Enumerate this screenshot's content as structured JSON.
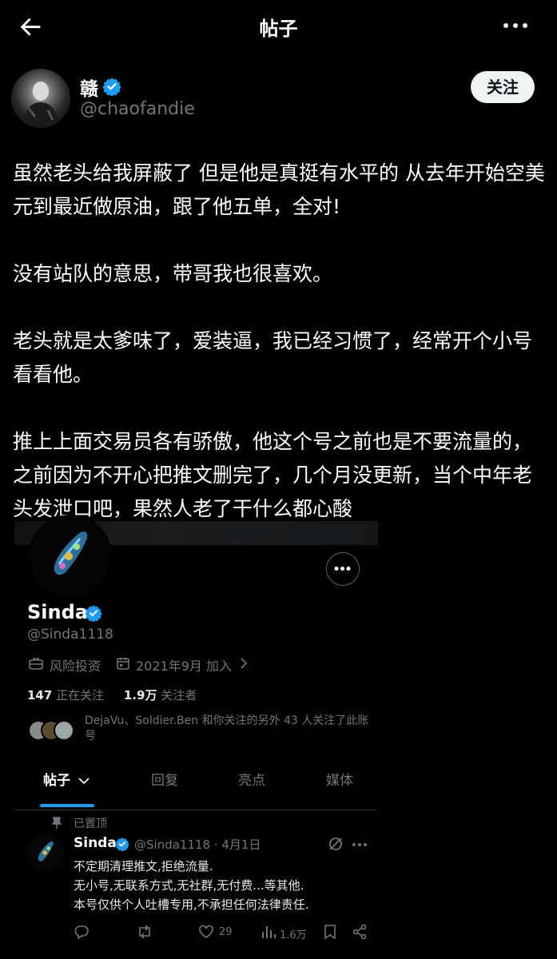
{
  "topbar": {
    "title": "帖子"
  },
  "author": {
    "name": "赣",
    "handle": "@chaofandie",
    "follow_label": "关注"
  },
  "post": {
    "paragraphs": [
      "虽然老头给我屏蔽了 但是他是真挺有水平的 从去年开始空美元到最近做原油，跟了他五单，全对!",
      "没有站队的意思，带哥我也很喜欢。",
      "老头就是太爹味了，爱装逼，我已经习惯了，经常开个小号看看他。",
      "推上上面交易员各有骄傲，他这个号之前也是不要流量的，之前因为不开心把推文删完了，几个月没更新，当个中年老头发泄口吧，果然人老了干什么都心酸"
    ]
  },
  "embed": {
    "profile": {
      "name": "Sinda",
      "handle": "@Sinda1118",
      "category": "风险投资",
      "joined": "2021年9月 加入",
      "following_count": "147",
      "following_label": "正在关注",
      "followers_count": "1.9万",
      "followers_label": "关注者",
      "followed_by_note": "DejaVu、Soldier.Ben 和你关注的另外 43 人关注了此账号"
    },
    "tabs": [
      {
        "label": "帖子",
        "active": true
      },
      {
        "label": "回复",
        "active": false
      },
      {
        "label": "亮点",
        "active": false
      },
      {
        "label": "媒体",
        "active": false
      }
    ],
    "pinned_label": "已置顶",
    "tweet": {
      "name": "Sinda",
      "handle_date": "@Sinda1118 · 4月1日",
      "lines": [
        "不定期清理推文,拒绝流量.",
        "无小号,无联系方式,无社群,无付费...等其他.",
        "本号仅供个人吐槽专用,不承担任何法律责任."
      ],
      "likes": "29",
      "views": "1.6万"
    }
  },
  "colors": {
    "background": "#000000",
    "verified": "#1d9bf0",
    "secondary_text": "#71767b"
  }
}
